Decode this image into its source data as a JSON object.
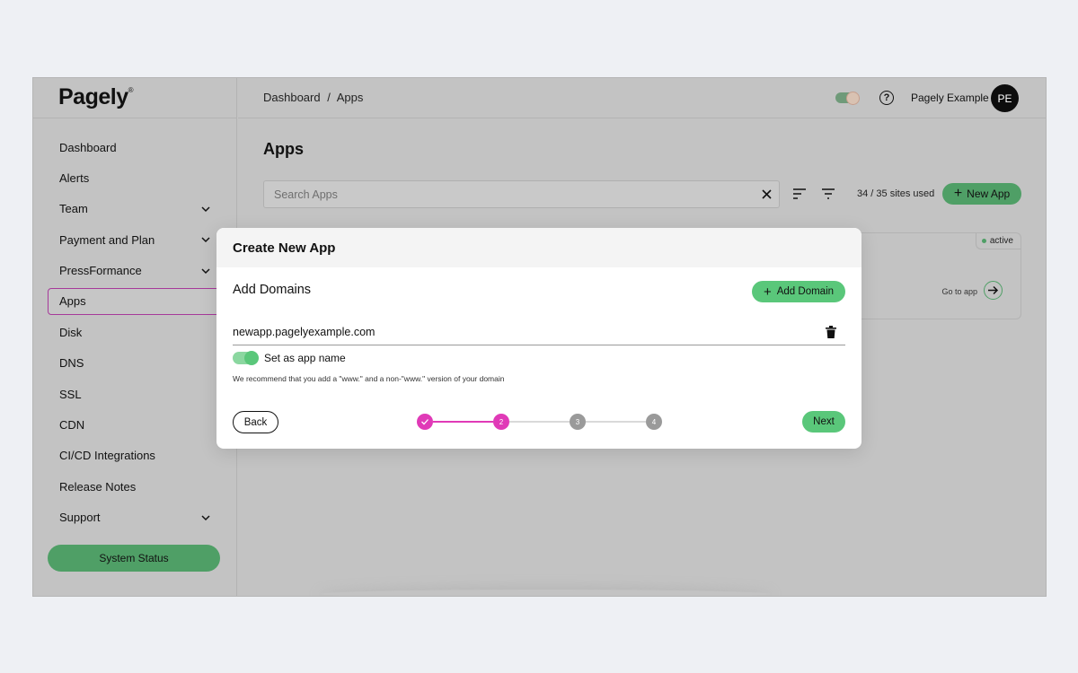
{
  "sidebar": {
    "logo": "Pagely",
    "logo_mark": "®",
    "items": [
      {
        "label": "Dashboard"
      },
      {
        "label": "Alerts"
      },
      {
        "label": "Team"
      },
      {
        "label": "Payment and Plan"
      },
      {
        "label": "PressFormance"
      },
      {
        "label": "Apps",
        "active": true
      },
      {
        "label": "Disk"
      },
      {
        "label": "DNS"
      },
      {
        "label": "SSL"
      },
      {
        "label": "CDN"
      },
      {
        "label": "CI/CD Integrations"
      },
      {
        "label": "Release Notes"
      },
      {
        "label": "Support"
      }
    ],
    "system_status": "System Status"
  },
  "header": {
    "breadcrumb": [
      "Dashboard",
      "/",
      "Apps"
    ],
    "user_name": "Pagely Example",
    "avatar_initials": "PE"
  },
  "main": {
    "title": "Apps",
    "search_placeholder": "Search Apps",
    "sites_used": "34 / 35 sites used",
    "new_app_label": "New App",
    "card": {
      "status": "active",
      "go_to_app": "Go to app"
    }
  },
  "modal": {
    "title": "Create New App",
    "section_title": "Add Domains",
    "add_domain_label": "Add Domain",
    "domain_value": "newapp.pagelyexample.com",
    "toggle_label": "Set as app name",
    "toggle_on": true,
    "hint": "We recommend that you add a \"www.\" and a non-\"www.\" version of your domain",
    "back_label": "Back",
    "next_label": "Next",
    "steps": [
      "1",
      "2",
      "3",
      "4"
    ],
    "current_step": 2
  },
  "colors": {
    "accent_green": "#5ac77a",
    "accent_pink": "#e03ab7",
    "overlay_gray": "#c3c3c3"
  }
}
